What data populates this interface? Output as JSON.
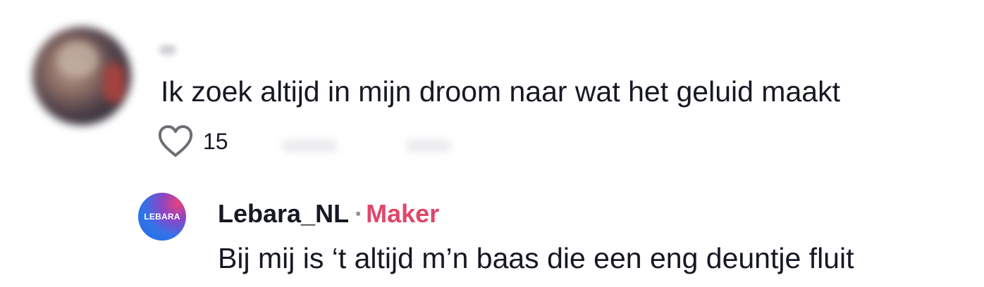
{
  "comment": {
    "avatar_icon": "user-avatar-blurred",
    "text": "Ik zoek altijd in mijn droom naar wat het geluid maakt",
    "like_icon": "heart-outline-icon",
    "like_count": "15"
  },
  "reply": {
    "avatar_logo_text": "LEBARA",
    "username": "Lebara_NL",
    "separator": "·",
    "badge": "Maker",
    "text": "Bij mij is ‘t altijd m’n baas die een eng deuntje fluit",
    "colors": {
      "badge": "#e0466a",
      "avatar_blue": "#1f6fe6",
      "avatar_pink": "#e5427a"
    }
  }
}
